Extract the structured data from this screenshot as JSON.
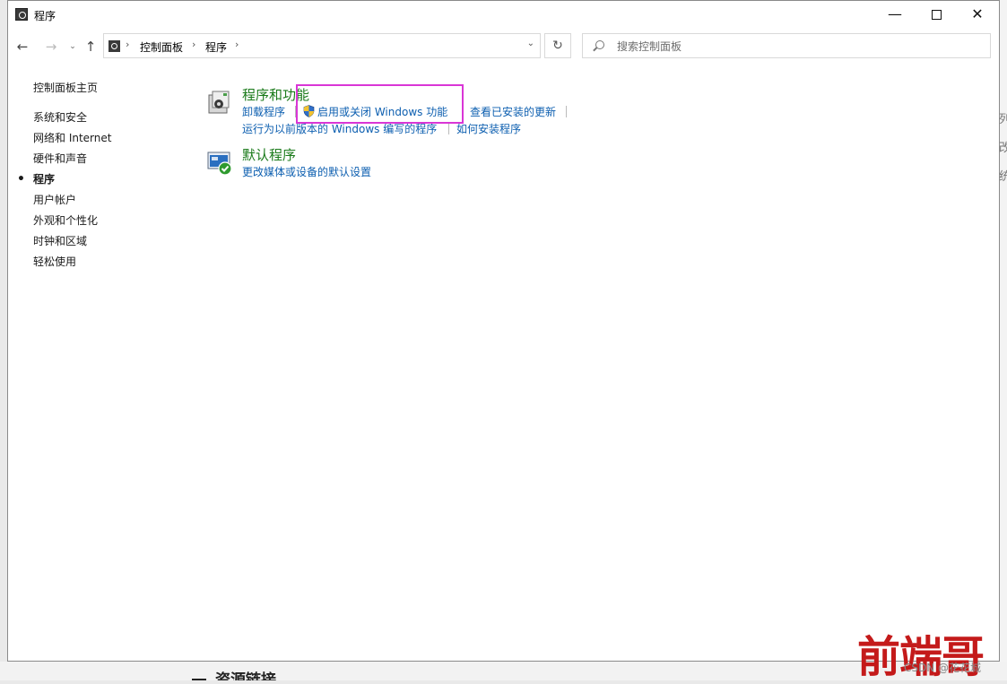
{
  "window": {
    "title": "程序",
    "controls": {
      "minimize": "—",
      "maximize": "",
      "close": "✕"
    }
  },
  "nav": {
    "back": "←",
    "forward": "→",
    "recent": "⌄",
    "up": "↑",
    "breadcrumbs": [
      "控制面板",
      "程序"
    ],
    "separator": "›",
    "dropdown": "⌄",
    "refresh": "↻",
    "search_placeholder": "搜索控制面板"
  },
  "sidebar": {
    "home": "控制面板主页",
    "items": [
      "系统和安全",
      "网络和 Internet",
      "硬件和声音",
      "程序",
      "用户帐户",
      "外观和个性化",
      "时钟和区域",
      "轻松使用"
    ],
    "active_index": 3,
    "bullet": "•"
  },
  "categories": [
    {
      "title": "程序和功能",
      "icon": "programs-features-icon",
      "links_row1": [
        "卸载程序",
        "启用或关闭 Windows 功能",
        "查看已安装的更新"
      ],
      "links_row2": [
        "运行为以前版本的 Windows 编写的程序",
        "如何安装程序"
      ]
    },
    {
      "title": "默认程序",
      "icon": "default-programs-icon",
      "links_row1": [
        "更改媒体或设备的默认设置"
      ]
    }
  ],
  "background": {
    "heading": "资源链接",
    "right_chars": [
      "列",
      "改",
      "统"
    ]
  },
  "watermark": {
    "text": "前端哥",
    "credit": "CSDN @花花城"
  },
  "colors": {
    "link": "#0d5fb0",
    "category_title": "#1a7a1a",
    "highlight": "#d936d6"
  }
}
